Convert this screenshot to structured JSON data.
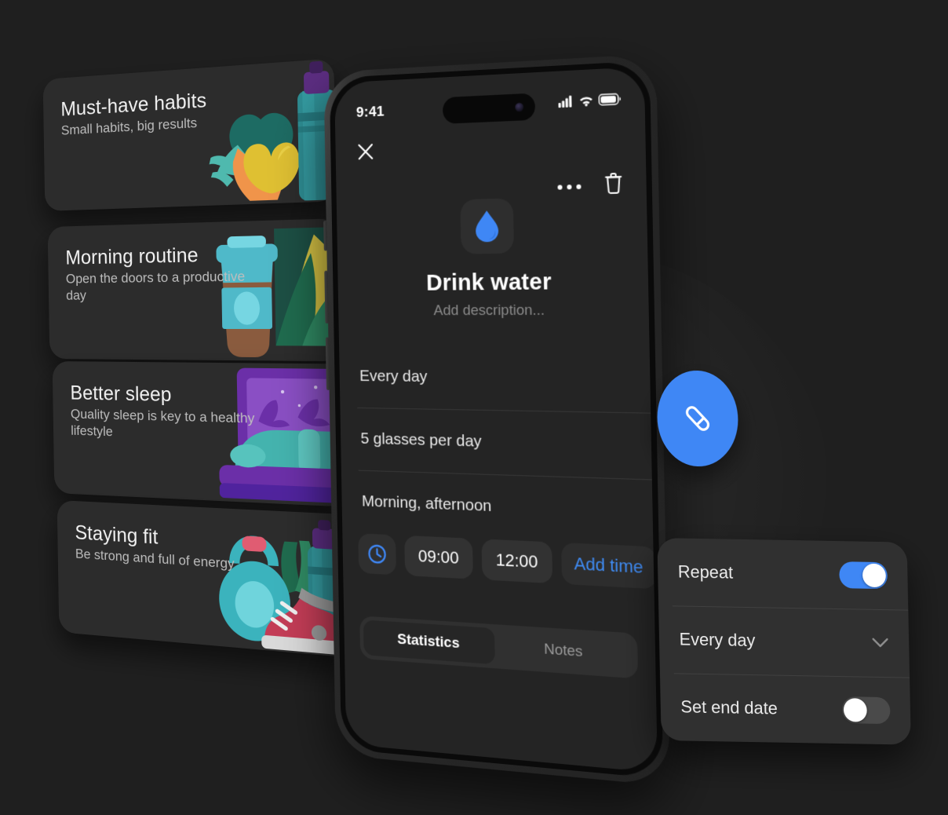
{
  "theme": {
    "background": "#1f1f1f",
    "card_bg": "#2c2c2c",
    "accent_blue": "#3f87f5",
    "screen_bg": "#242424",
    "panel_bg": "#303030"
  },
  "cards": [
    {
      "title": "Must-have habits",
      "subtitle": "Small habits, big results",
      "art": "vegetables-bottle-illustration"
    },
    {
      "title": "Morning routine",
      "subtitle": "Open the doors to a productive day",
      "art": "coffee-cup-plant-illustration"
    },
    {
      "title": "Better sleep",
      "subtitle": "Quality sleep is key to a healthy lifestyle",
      "art": "bed-night-window-illustration"
    },
    {
      "title": "Staying fit",
      "subtitle": "Be strong and full of energy",
      "art": "kettlebell-sneaker-bottle-illustration"
    }
  ],
  "phone": {
    "status_bar": {
      "time": "9:41",
      "signal_icon": "cellular-signal-icon",
      "wifi_icon": "wifi-icon",
      "battery_icon": "battery-icon"
    },
    "header": {
      "close_icon": "close-icon",
      "more_icon": "more-options-icon",
      "delete_icon": "trash-icon"
    },
    "habit": {
      "icon": "water-drop-icon",
      "title": "Drink water",
      "description_placeholder": "Add description..."
    },
    "detail_rows": [
      {
        "label": "Every day"
      },
      {
        "label": "5 glasses per day"
      },
      {
        "label": "Morning, afternoon"
      }
    ],
    "reminders": {
      "clock_icon": "clock-icon",
      "times": [
        "09:00",
        "12:00"
      ],
      "add_label": "Add time"
    },
    "tabs": [
      {
        "label": "Statistics",
        "active": true
      },
      {
        "label": "Notes",
        "active": false
      }
    ]
  },
  "fab": {
    "icon": "pencil-edit-icon",
    "color": "#3f87f5"
  },
  "repeat_panel": {
    "rows": [
      {
        "label": "Repeat",
        "control": "toggle",
        "state": "on"
      },
      {
        "label": "Every day",
        "control": "chevron",
        "icon": "chevron-down-icon"
      },
      {
        "label": "Set end date",
        "control": "toggle",
        "state": "off"
      }
    ]
  }
}
